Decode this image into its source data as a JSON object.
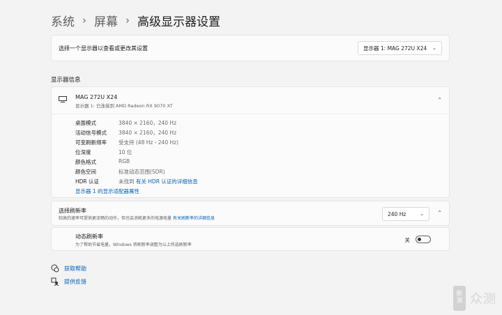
{
  "breadcrumb": {
    "items": [
      "系统",
      "屏幕"
    ],
    "separator": "›",
    "current": "高级显示器设置"
  },
  "display_select": {
    "label": "选择一个显示器以查看或更改其设置",
    "value": "显示器 1: MAG 272U X24"
  },
  "section_title": "显示器信息",
  "monitor": {
    "name": "MAG 272U X24",
    "subtitle": "显示器 1: 已连接到 AMD Radeon RX 9070 XT",
    "rows": [
      {
        "key": "桌面模式",
        "value": "3840 × 2160，240 Hz"
      },
      {
        "key": "活动信号模式",
        "value": "3840 × 2160，240 Hz"
      },
      {
        "key": "可变刷新频率",
        "value": "受支持 (48 Hz - 240 Hz)"
      },
      {
        "key": "位深度",
        "value": "10 位"
      },
      {
        "key": "颜色格式",
        "value": "RGB"
      },
      {
        "key": "颜色空间",
        "value": "标准动态范围(SDR)"
      }
    ],
    "hdr": {
      "key": "HDR 认证",
      "value": "未找到",
      "link": "有关 HDR 认证的详细信息"
    },
    "adapter_link": "显示器 1 的显示适配器属性"
  },
  "refresh": {
    "title": "选择刷新率",
    "desc": "较高的速率可提供更流畅的动作，但也会消耗更多的电源电量",
    "link": "有关刷新率的详细信息",
    "value": "240 Hz"
  },
  "dynamic": {
    "title": "动态刷新率",
    "desc": "为了帮助节省电量，Windows 将刷新率调整为以上所选刷新率",
    "toggle_label": "关",
    "on": false
  },
  "footer": {
    "help": "获取帮助",
    "feedback": "提供反馈"
  },
  "watermark": {
    "badge": [
      "新",
      "浪"
    ],
    "text": "众测"
  },
  "colors": {
    "accent": "#005fb8",
    "background": "#f3f3f3",
    "card": "#fbfbfb"
  }
}
